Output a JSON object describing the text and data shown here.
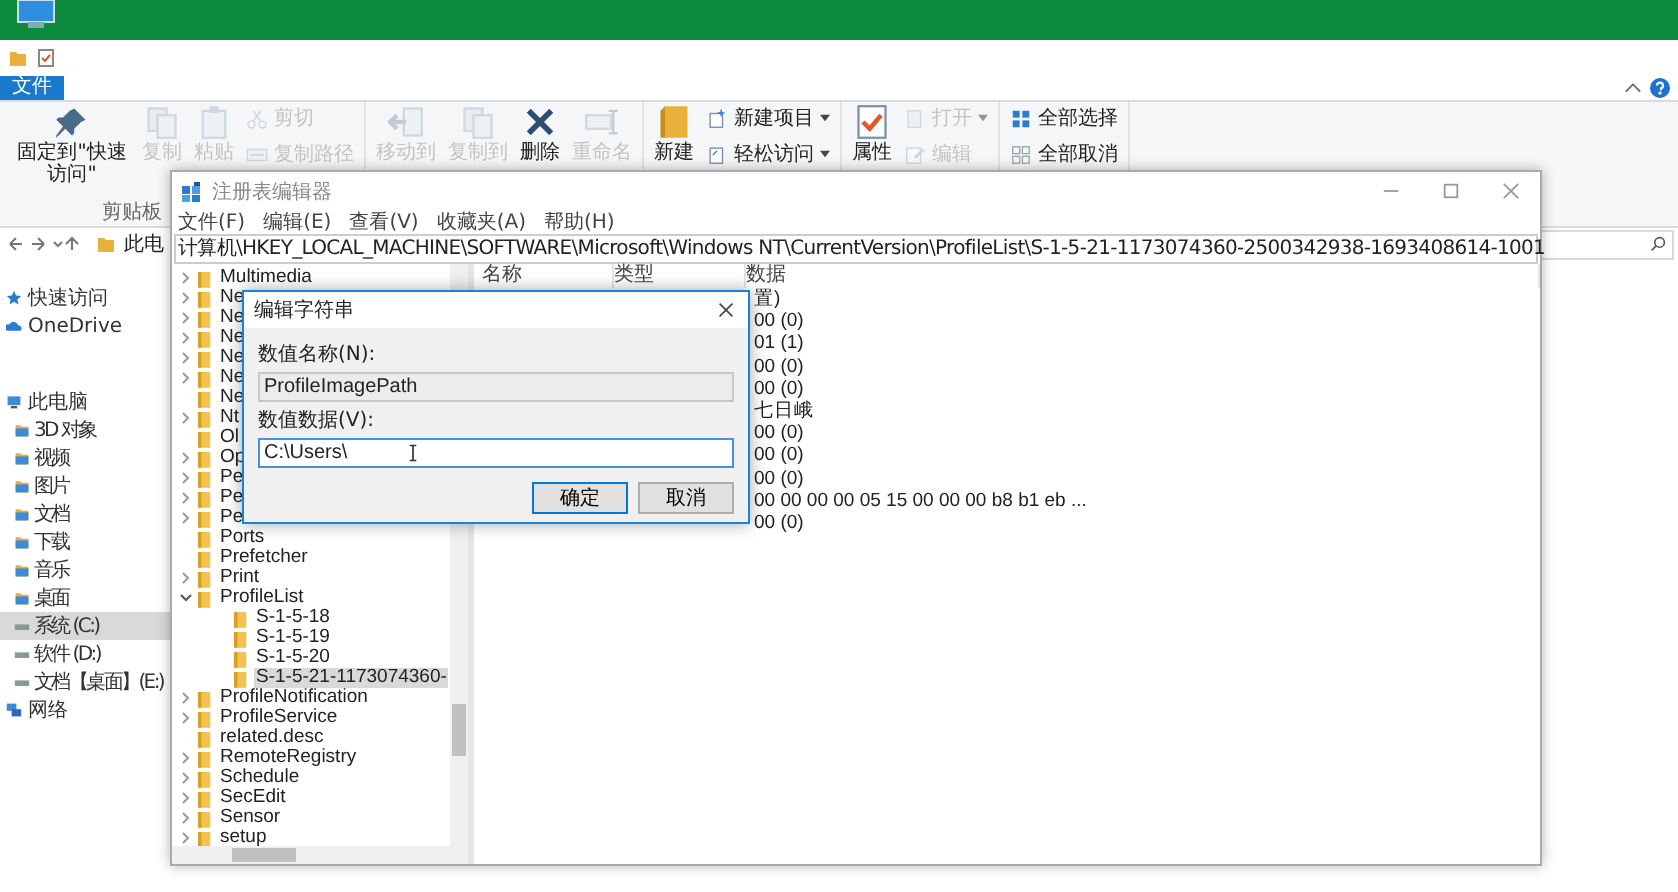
{
  "explorer": {
    "ribbon_tabs": [
      {
        "label": "文件",
        "selected": true
      }
    ],
    "ribbon_groups": [
      {
        "label": "剪贴板",
        "items": [
          {
            "label": "固定到\"快速访问\"",
            "kind": "large",
            "disabled": false
          },
          {
            "label": "复制",
            "kind": "large",
            "disabled": true
          },
          {
            "label": "粘贴",
            "kind": "large",
            "disabled": true
          },
          {
            "label": "剪切",
            "kind": "small",
            "disabled": true
          },
          {
            "label": "复制路径",
            "kind": "small",
            "disabled": true
          }
        ]
      },
      {
        "items": [
          {
            "label": "移动到",
            "kind": "large",
            "disabled": true
          },
          {
            "label": "复制到",
            "kind": "large",
            "disabled": true
          },
          {
            "label": "删除",
            "kind": "large",
            "disabled": false
          },
          {
            "label": "重命名",
            "kind": "large",
            "disabled": true
          }
        ]
      },
      {
        "items": [
          {
            "label": "新建",
            "kind": "large",
            "disabled": false
          },
          {
            "label": "新建项目",
            "kind": "small",
            "disabled": false,
            "dropdown": true
          },
          {
            "label": "轻松访问",
            "kind": "small",
            "disabled": false,
            "dropdown": true
          }
        ]
      },
      {
        "items": [
          {
            "label": "属性",
            "kind": "large",
            "disabled": false
          },
          {
            "label": "打开",
            "kind": "small",
            "disabled": true,
            "dropdown": true
          },
          {
            "label": "编辑",
            "kind": "small",
            "disabled": true
          }
        ]
      },
      {
        "items": [
          {
            "label": "全部选择",
            "kind": "small",
            "disabled": false
          },
          {
            "label": "全部取消",
            "kind": "small",
            "disabled": false
          }
        ]
      }
    ],
    "address": "此电",
    "nav_pane": [
      {
        "label": "快速访问",
        "kind": "star",
        "selected": false
      },
      {
        "label": "OneDrive",
        "kind": "cloud",
        "selected": false
      },
      {
        "label": "此电脑",
        "kind": "computer",
        "selected": false,
        "children": [
          {
            "label": "3D 对象",
            "kind": "folder",
            "selected": false
          },
          {
            "label": "视频",
            "kind": "folder",
            "selected": false
          },
          {
            "label": "图片",
            "kind": "folder",
            "selected": false
          },
          {
            "label": "文档",
            "kind": "folder",
            "selected": false
          },
          {
            "label": "下载",
            "kind": "folder",
            "selected": false
          },
          {
            "label": "音乐",
            "kind": "folder",
            "selected": false
          },
          {
            "label": "桌面",
            "kind": "folder",
            "selected": false
          },
          {
            "label": "系统 (C:)",
            "kind": "drive",
            "selected": true
          },
          {
            "label": "软件 (D:)",
            "kind": "drive",
            "selected": false
          },
          {
            "label": "文档【桌面】(E:)",
            "kind": "drive",
            "selected": false
          }
        ]
      },
      {
        "label": "网络",
        "kind": "network",
        "selected": false
      }
    ]
  },
  "regedit": {
    "title": "注册表编辑器",
    "menu": [
      "文件(F)",
      "编辑(E)",
      "查看(V)",
      "收藏夹(A)",
      "帮助(H)"
    ],
    "address": "计算机\\HKEY_LOCAL_MACHINE\\SOFTWARE\\Microsoft\\Windows NT\\CurrentVersion\\ProfileList\\S-1-5-21-1173074360-2500342938-1693408614-1001",
    "tree": [
      {
        "label": "Multimedia",
        "expanded": false,
        "selected": false
      },
      {
        "label": "Ne",
        "expanded": false,
        "selected": false
      },
      {
        "label": "Ne",
        "expanded": false,
        "selected": false
      },
      {
        "label": "Ne",
        "expanded": false,
        "selected": false
      },
      {
        "label": "Ne",
        "expanded": false,
        "selected": false
      },
      {
        "label": "Ne",
        "expanded": false,
        "selected": false
      },
      {
        "label": "Ne",
        "selected": false
      },
      {
        "label": "Nt",
        "expanded": false,
        "selected": false
      },
      {
        "label": "Ol",
        "selected": false
      },
      {
        "label": "Op",
        "expanded": false,
        "selected": false
      },
      {
        "label": "Pe",
        "expanded": false,
        "selected": false
      },
      {
        "label": "Pe",
        "expanded": false,
        "selected": false
      },
      {
        "label": "Pe",
        "expanded": false,
        "selected": false
      },
      {
        "label": "Ports",
        "selected": false
      },
      {
        "label": "Prefetcher",
        "selected": false
      },
      {
        "label": "Print",
        "expanded": false,
        "selected": false
      },
      {
        "label": "ProfileList",
        "expanded": true,
        "selected": false,
        "children": [
          {
            "label": "S-1-5-18",
            "selected": false
          },
          {
            "label": "S-1-5-19",
            "selected": false
          },
          {
            "label": "S-1-5-20",
            "selected": false
          },
          {
            "label": "S-1-5-21-1173074360-",
            "selected": true
          }
        ]
      },
      {
        "label": "ProfileNotification",
        "expanded": false,
        "selected": false
      },
      {
        "label": "ProfileService",
        "expanded": false,
        "selected": false
      },
      {
        "label": "related.desc",
        "selected": false
      },
      {
        "label": "RemoteRegistry",
        "expanded": false,
        "selected": false
      },
      {
        "label": "Schedule",
        "expanded": false,
        "selected": false
      },
      {
        "label": "SecEdit",
        "expanded": false,
        "selected": false
      },
      {
        "label": "Sensor",
        "expanded": false,
        "selected": false
      },
      {
        "label": "setup",
        "expanded": false,
        "selected": false
      }
    ],
    "columns": [
      "名称",
      "类型",
      "数据"
    ],
    "rows": [
      {
        "data": "置)"
      },
      {
        "data": "00 (0)"
      },
      {
        "data": "01 (1)"
      },
      {
        "data": "00 (0)"
      },
      {
        "data": "00 (0)"
      },
      {
        "data": "七日峨"
      },
      {
        "data": "00 (0)"
      },
      {
        "data": "00 (0)"
      },
      {
        "data": "00 (0)"
      },
      {
        "data": "00 00 00 00 05 15 00 00 00 b8 b1 eb ..."
      },
      {
        "data": "00 (0)"
      }
    ]
  },
  "dialog": {
    "title": "编辑字符串",
    "name_label": "数值名称(N):",
    "name_value": "ProfileImagePath",
    "data_label": "数值数据(V):",
    "data_value": "C:\\Users\\",
    "buttons": [
      {
        "label": "确定",
        "default": true
      },
      {
        "label": "取消",
        "default": false
      }
    ]
  }
}
